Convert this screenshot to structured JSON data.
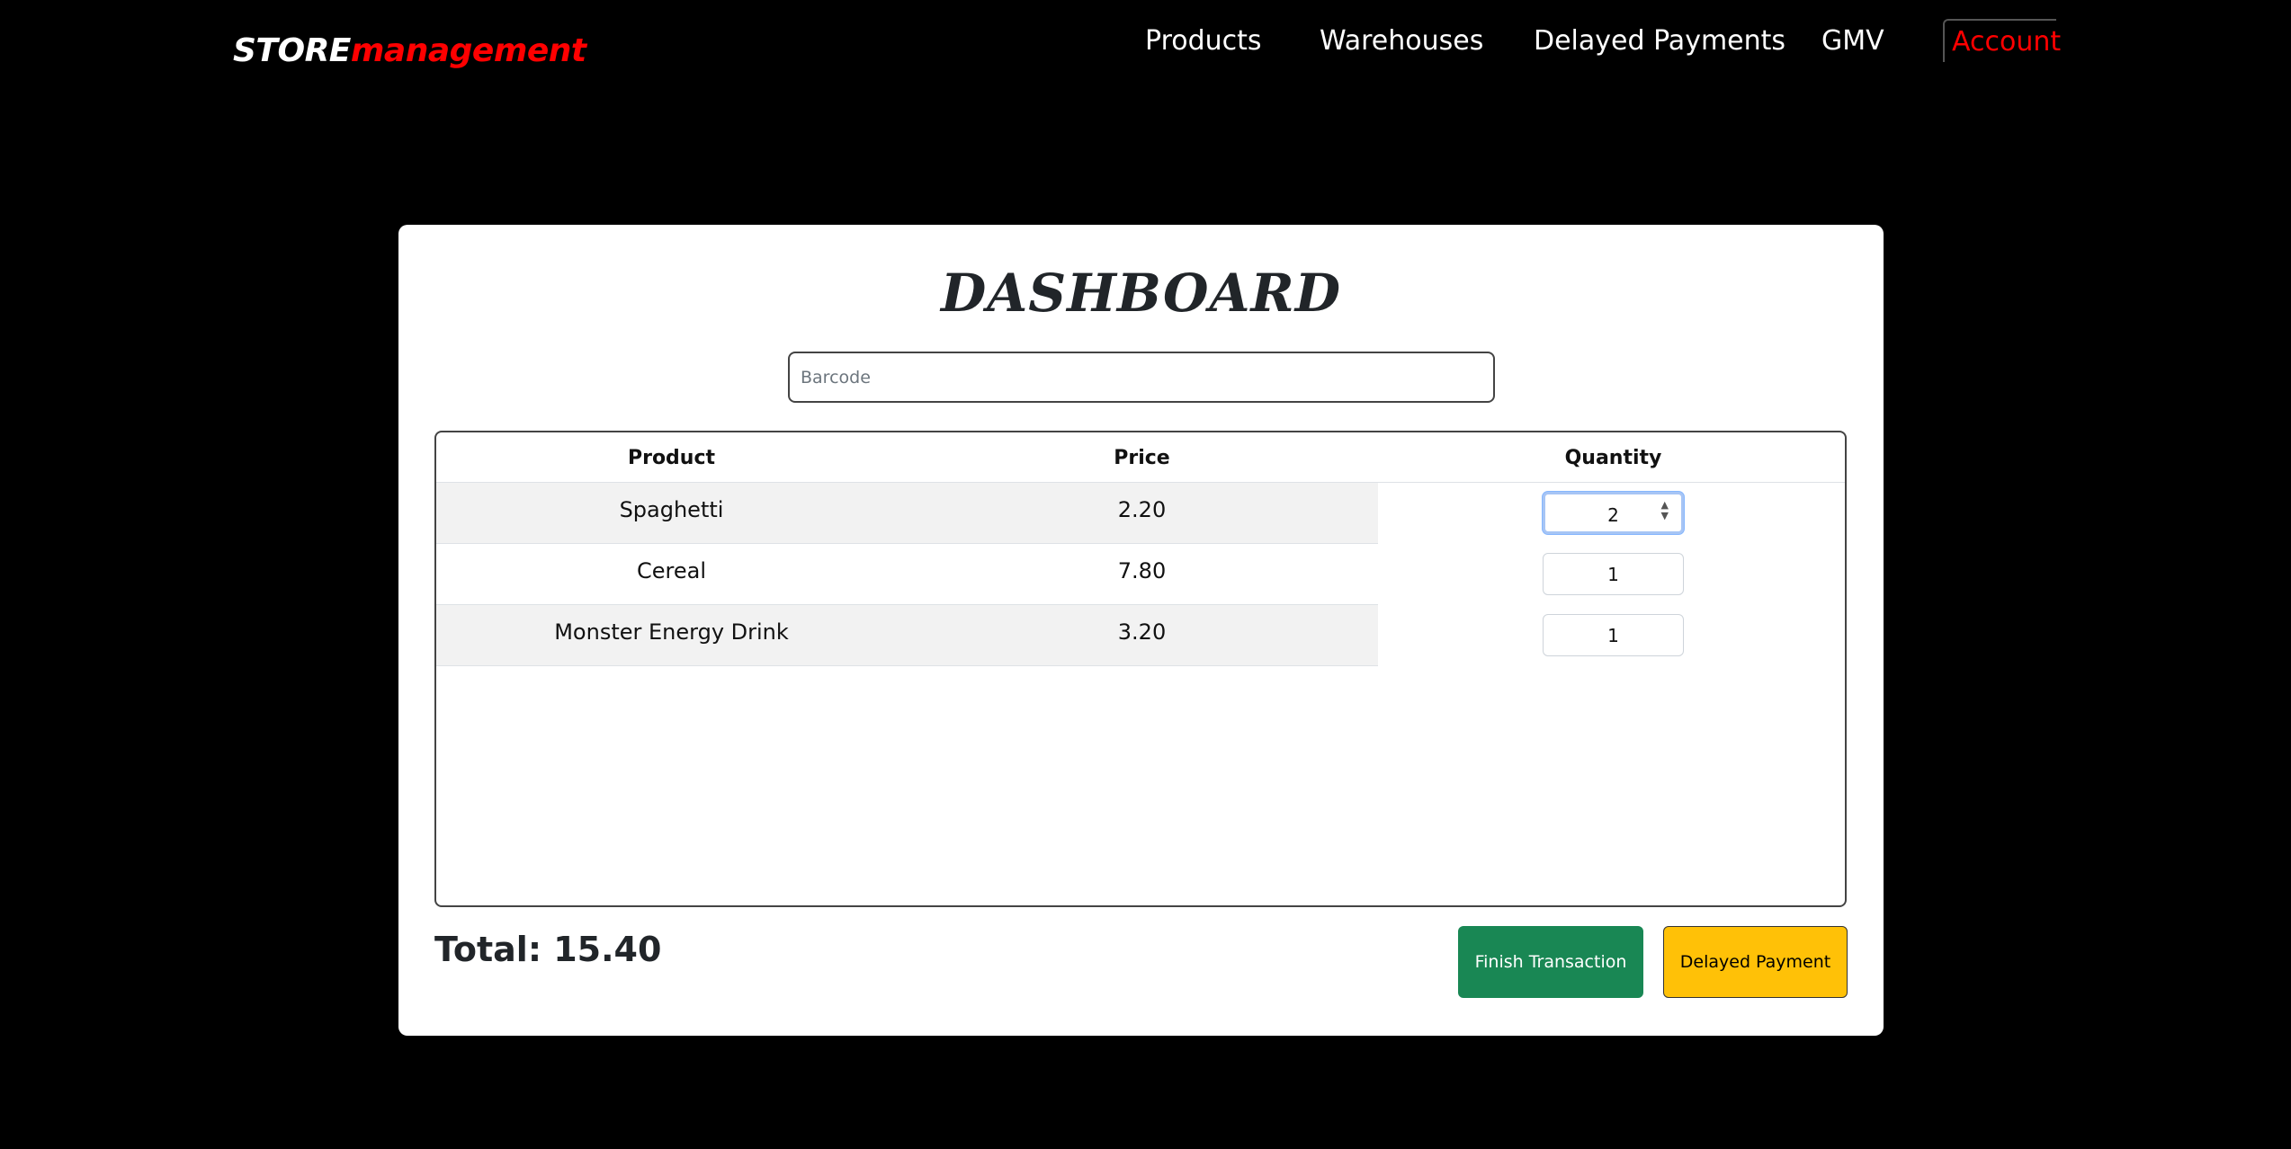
{
  "navbar": {
    "brand_part1": "STORE",
    "brand_part2": "management",
    "items": [
      {
        "label": "Products"
      },
      {
        "label": "Warehouses"
      },
      {
        "label": "Delayed Payments"
      },
      {
        "label": "GMV"
      }
    ],
    "account_label": "Account"
  },
  "dashboard": {
    "title": "DASHBOARD",
    "barcode_placeholder": "Barcode",
    "table": {
      "headers": [
        "Product",
        "Price",
        "Quantity"
      ],
      "rows": [
        {
          "product": "Spaghetti",
          "price": "2.20",
          "quantity": "2"
        },
        {
          "product": "Cereal",
          "price": "7.80",
          "quantity": "1"
        },
        {
          "product": "Monster Energy Drink",
          "price": "3.20",
          "quantity": "1"
        }
      ]
    },
    "total_label": "Total: 15.40",
    "finish_button": "Finish Transaction",
    "delayed_button": "Delayed Payment"
  },
  "colors": {
    "background": "#000000",
    "brand_accent": "#ff0000",
    "finish_button": "#198754",
    "delayed_button": "#ffc107"
  }
}
